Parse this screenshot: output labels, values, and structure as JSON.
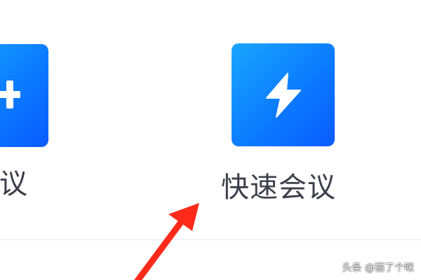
{
  "tiles": {
    "left": {
      "label": "会议",
      "icon": "plus-icon"
    },
    "quick": {
      "label": "快速会议",
      "icon": "lightning-bolt-icon"
    }
  },
  "annotation": {
    "icon": "red-arrow",
    "color": "#ff2a1a"
  },
  "watermark": {
    "text": "头条 @猫了个咪"
  },
  "colors": {
    "tile_gradient_start": "#1aa6ff",
    "tile_gradient_end": "#0a5bff",
    "label_text": "#3b3f49",
    "background": "#ffffff"
  }
}
